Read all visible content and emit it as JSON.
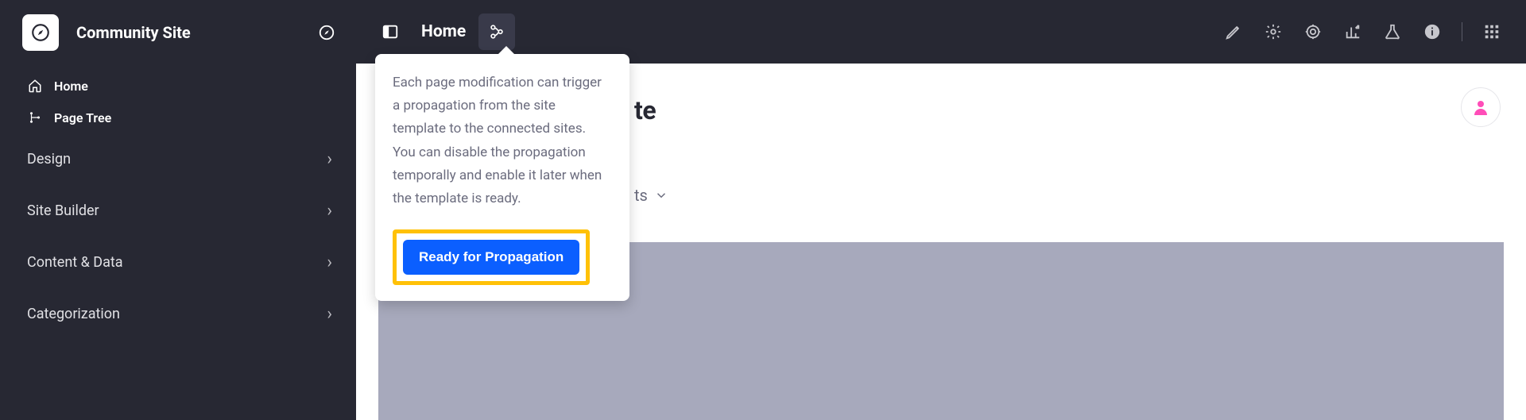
{
  "brand": {
    "title": "Community Site"
  },
  "sidenav": {
    "items": [
      {
        "label": "Home"
      },
      {
        "label": "Page Tree"
      }
    ],
    "sections": [
      {
        "label": "Design"
      },
      {
        "label": "Site Builder"
      },
      {
        "label": "Content & Data"
      },
      {
        "label": "Categorization"
      }
    ]
  },
  "topbar": {
    "home_label": "Home"
  },
  "popover": {
    "text": "Each page modification can trigger a propagation from the site template to the connected sites. You can disable the propagation temporally and enable it later when the template is ready.",
    "cta_label": "Ready for Propagation"
  },
  "content": {
    "partial_title_suffix": "te",
    "fragments_label_suffix": "ts"
  }
}
